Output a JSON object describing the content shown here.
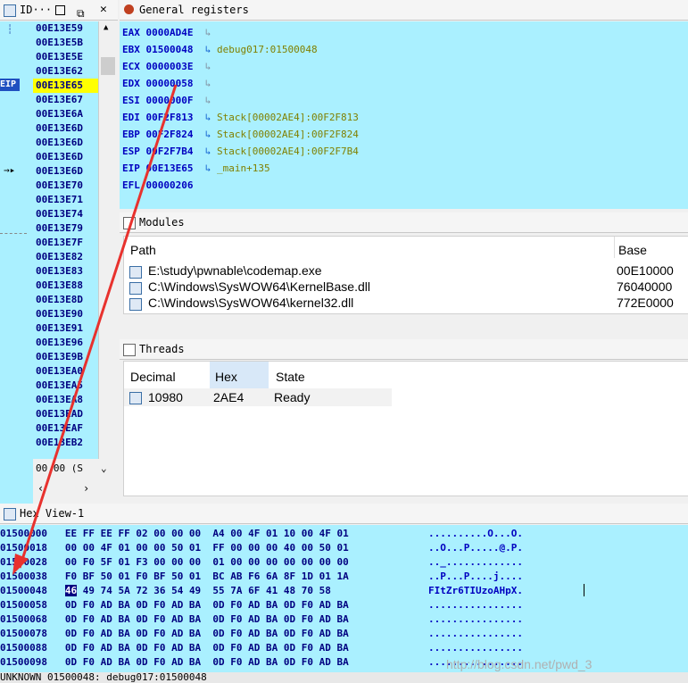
{
  "ida_panel": {
    "title": "ID···",
    "eip_label": "EIP",
    "addresses": [
      "00E13E59",
      "00E13E5B",
      "00E13E5E",
      "00E13E62",
      "00E13E65",
      "00E13E67",
      "00E13E6A",
      "00E13E6D",
      "00E13E6D",
      "00E13E6D",
      "00E13E6D",
      "00E13E70",
      "00E13E71",
      "00E13E74",
      "00E13E79",
      "00E13E7F",
      "00E13E82",
      "00E13E83",
      "00E13E88",
      "00E13E8D",
      "00E13E90",
      "00E13E91",
      "00E13E96",
      "00E13E9B",
      "00E13EA0",
      "00E13EA5",
      "00E13EA8",
      "00E13EAD",
      "00E13EAF",
      "00E13EB2"
    ],
    "highlighted_index": 4,
    "bottom_text": "00 00 (S"
  },
  "registers": {
    "title": "General registers",
    "rows": [
      {
        "name": "EAX",
        "value": "0000AD4E",
        "comment": ""
      },
      {
        "name": "EBX",
        "value": "01500048",
        "comment": "debug017:01500048"
      },
      {
        "name": "ECX",
        "value": "0000003E",
        "comment": ""
      },
      {
        "name": "EDX",
        "value": "00000058",
        "comment": ""
      },
      {
        "name": "ESI",
        "value": "0000000F",
        "comment": ""
      },
      {
        "name": "EDI",
        "value": "00F2F813",
        "comment": "Stack[00002AE4]:00F2F813"
      },
      {
        "name": "EBP",
        "value": "00F2F824",
        "comment": "Stack[00002AE4]:00F2F824"
      },
      {
        "name": "ESP",
        "value": "00F2F7B4",
        "comment": "Stack[00002AE4]:00F2F7B4"
      },
      {
        "name": "EIP",
        "value": "00E13E65",
        "comment": "_main+135"
      },
      {
        "name": "EFL",
        "value": "00000206",
        "comment": ""
      }
    ]
  },
  "modules": {
    "title": "Modules",
    "headers": {
      "path": "Path",
      "base": "Base"
    },
    "rows": [
      {
        "path": "E:\\study\\pwnable\\codemap.exe",
        "base": "00E10000"
      },
      {
        "path": "C:\\Windows\\SysWOW64\\KernelBase.dll",
        "base": "76040000"
      },
      {
        "path": "C:\\Windows\\SysWOW64\\kernel32.dll",
        "base": "772E0000"
      }
    ]
  },
  "threads": {
    "title": "Threads",
    "headers": {
      "decimal": "Decimal",
      "hex": "Hex",
      "state": "State"
    },
    "rows": [
      {
        "decimal": "10980",
        "hex": "2AE4",
        "state": "Ready"
      }
    ]
  },
  "hexview": {
    "title": "Hex View-1",
    "lines": [
      {
        "addr": "01500000",
        "bytes": "EE FF EE FF 02 00 00 00  A4 00 4F 01 10 00 4F 01",
        "ascii": "..........O...O."
      },
      {
        "addr": "01500018",
        "bytes": "00 00 4F 01 00 00 50 01  FF 00 00 00 40 00 50 01",
        "ascii": "..O...P.....@.P."
      },
      {
        "addr": "01500028",
        "bytes": "00 F0 5F 01 F3 00 00 00  01 00 00 00 00 00 00 00",
        "ascii": ".._............."
      },
      {
        "addr": "01500038",
        "bytes": "F0 BF 50 01 F0 BF 50 01  BC AB F6 6A 8F 1D 01 1A",
        "ascii": "..P...P....j...."
      },
      {
        "addr": "01500048",
        "bytes": "46 49 74 5A 72 36 54 49  55 7A 6F 41 48 70 58 ",
        "ascii": "FItZr6TIUzoAHpX.",
        "selected_first": true
      },
      {
        "addr": "01500058",
        "bytes": "0D F0 AD BA 0D F0 AD BA  0D F0 AD BA 0D F0 AD BA",
        "ascii": "................"
      },
      {
        "addr": "01500068",
        "bytes": "0D F0 AD BA 0D F0 AD BA  0D F0 AD BA 0D F0 AD BA",
        "ascii": "................"
      },
      {
        "addr": "01500078",
        "bytes": "0D F0 AD BA 0D F0 AD BA  0D F0 AD BA 0D F0 AD BA",
        "ascii": "................"
      },
      {
        "addr": "01500088",
        "bytes": "0D F0 AD BA 0D F0 AD BA  0D F0 AD BA 0D F0 AD BA",
        "ascii": "................"
      },
      {
        "addr": "01500098",
        "bytes": "0D F0 AD BA 0D F0 AD BA  0D F0 AD BA 0D F0 AD BA",
        "ascii": "................"
      }
    ],
    "status": "UNKNOWN 01500048: debug017:01500048"
  },
  "watermark": "http://blog.csdn.net/pwd_3",
  "colors": {
    "panel_bg": "#aaf0ff",
    "highlight": "#ffff00",
    "arrow": "#e8322e"
  }
}
